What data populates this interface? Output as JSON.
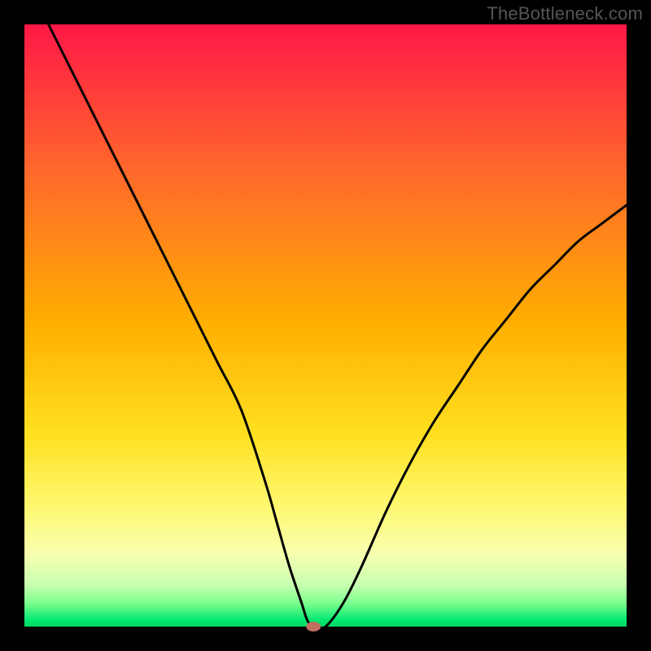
{
  "watermark": "TheBottleneck.com",
  "chart_data": {
    "type": "line",
    "title": "",
    "xlabel": "",
    "ylabel": "",
    "xlim": [
      0,
      100
    ],
    "ylim": [
      0,
      100
    ],
    "x": [
      4,
      8,
      12,
      16,
      20,
      24,
      28,
      32,
      36,
      40,
      42,
      44,
      46,
      47,
      48,
      50,
      53,
      56,
      60,
      64,
      68,
      72,
      76,
      80,
      84,
      88,
      92,
      96,
      100
    ],
    "values": [
      100,
      92,
      84,
      76,
      68,
      60,
      52,
      44,
      36,
      24,
      17,
      10,
      4,
      1,
      0,
      0,
      4,
      10,
      19,
      27,
      34,
      40,
      46,
      51,
      56,
      60,
      64,
      67,
      70
    ],
    "gradient_stops": [
      {
        "offset": 0,
        "color": "#ff1846"
      },
      {
        "offset": 25,
        "color": "#ff6a2a"
      },
      {
        "offset": 50,
        "color": "#ffb000"
      },
      {
        "offset": 68,
        "color": "#ffe020"
      },
      {
        "offset": 80,
        "color": "#fff870"
      },
      {
        "offset": 88,
        "color": "#f7ffb0"
      },
      {
        "offset": 93,
        "color": "#c8ffb0"
      },
      {
        "offset": 96,
        "color": "#80ff90"
      },
      {
        "offset": 99,
        "color": "#00e870"
      },
      {
        "offset": 100,
        "color": "#00d860"
      }
    ],
    "marker": {
      "x": 48,
      "y": 0,
      "color": "#c07060"
    },
    "border_color": "#000000"
  }
}
